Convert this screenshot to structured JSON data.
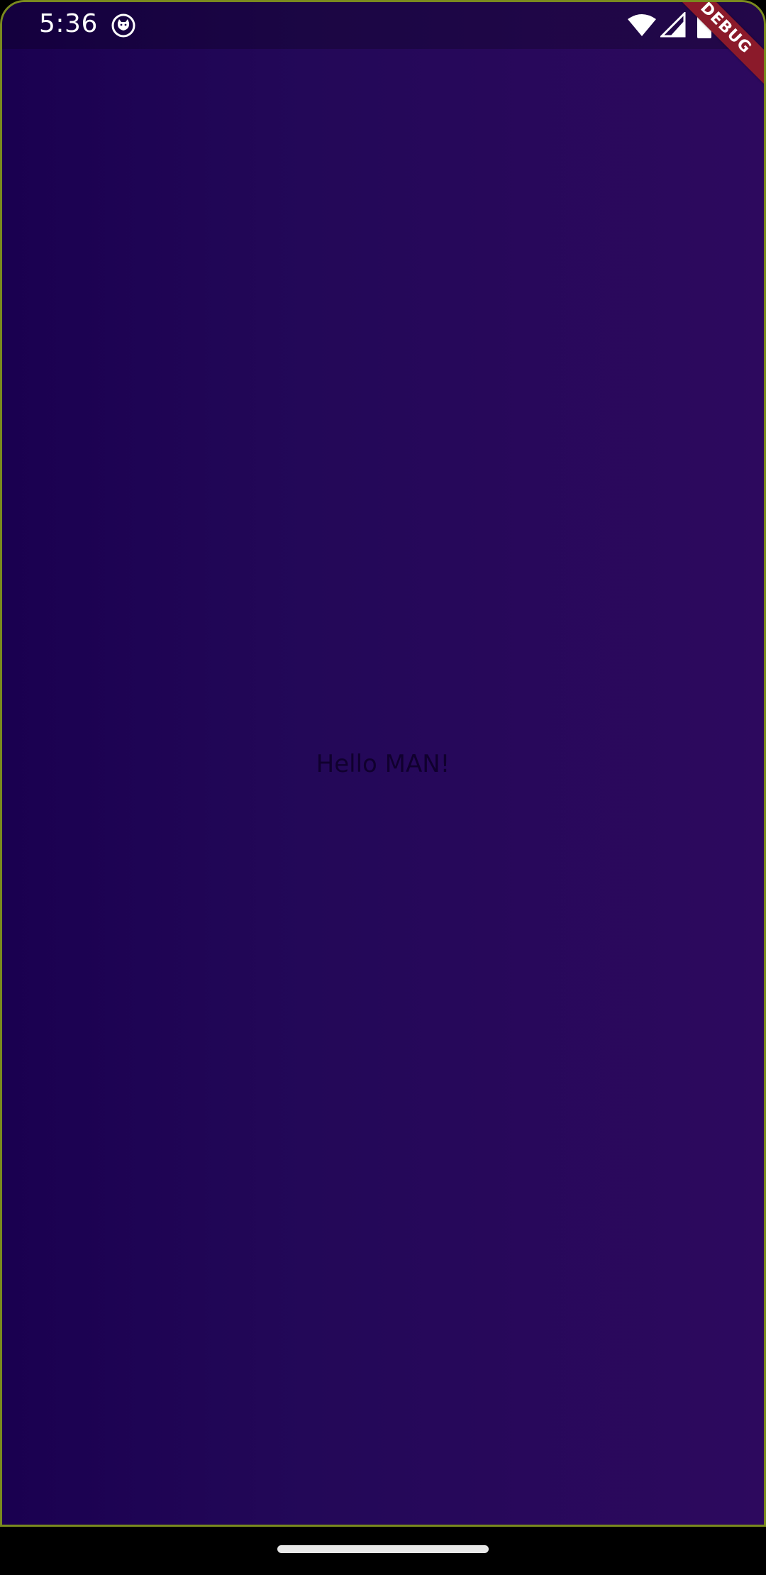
{
  "status_bar": {
    "time": "5:36",
    "icons": [
      "notification-icon",
      "wifi-icon",
      "signal-icon",
      "battery-icon"
    ]
  },
  "debug_banner": {
    "label": "DEBUG",
    "color": "#8b1a2a"
  },
  "main": {
    "greeting": "Hello MAN!"
  },
  "colors": {
    "background_start": "#1a0050",
    "background_end": "#2d095e",
    "text": "#10002e"
  }
}
